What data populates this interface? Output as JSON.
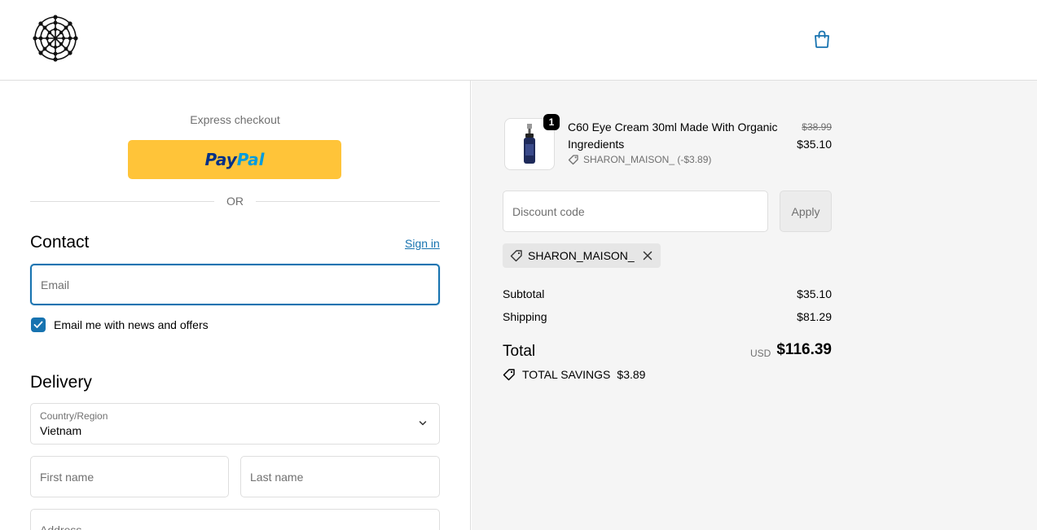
{
  "express": {
    "title": "Express checkout",
    "paypal_a": "Pay",
    "paypal_b": "Pal",
    "or": "OR"
  },
  "contact": {
    "heading": "Contact",
    "sign_in": "Sign in",
    "email_placeholder": "Email",
    "newsletter_label": "Email me with news and offers",
    "newsletter_checked": true
  },
  "delivery": {
    "heading": "Delivery",
    "country_label": "Country/Region",
    "country_value": "Vietnam",
    "first_name_placeholder": "First name",
    "last_name_placeholder": "Last name",
    "address_placeholder": "Address"
  },
  "order": {
    "product": {
      "quantity": "1",
      "name": "C60 Eye Cream 30ml Made With Organic Ingredients",
      "discount_line": "SHARON_MAISON_ (-$3.89)",
      "original_price": "$38.99",
      "price": "$35.10"
    },
    "discount_placeholder": "Discount code",
    "apply_label": "Apply",
    "applied_code": "SHARON_MAISON_",
    "subtotal_label": "Subtotal",
    "subtotal_value": "$35.10",
    "shipping_label": "Shipping",
    "shipping_value": "$81.29",
    "total_label": "Total",
    "currency": "USD",
    "total_value": "$116.39",
    "savings_label": "TOTAL SAVINGS",
    "savings_value": "$3.89"
  },
  "colors": {
    "accent": "#1773b0",
    "paypal": "#ffc439",
    "summary_bg": "#f5f5f5"
  },
  "icons": {
    "logo": "fullerene-logo",
    "cart": "shopping-bag-icon",
    "tag": "tag-icon",
    "close": "close-icon",
    "chevron": "chevron-down-icon",
    "check": "check-icon"
  }
}
